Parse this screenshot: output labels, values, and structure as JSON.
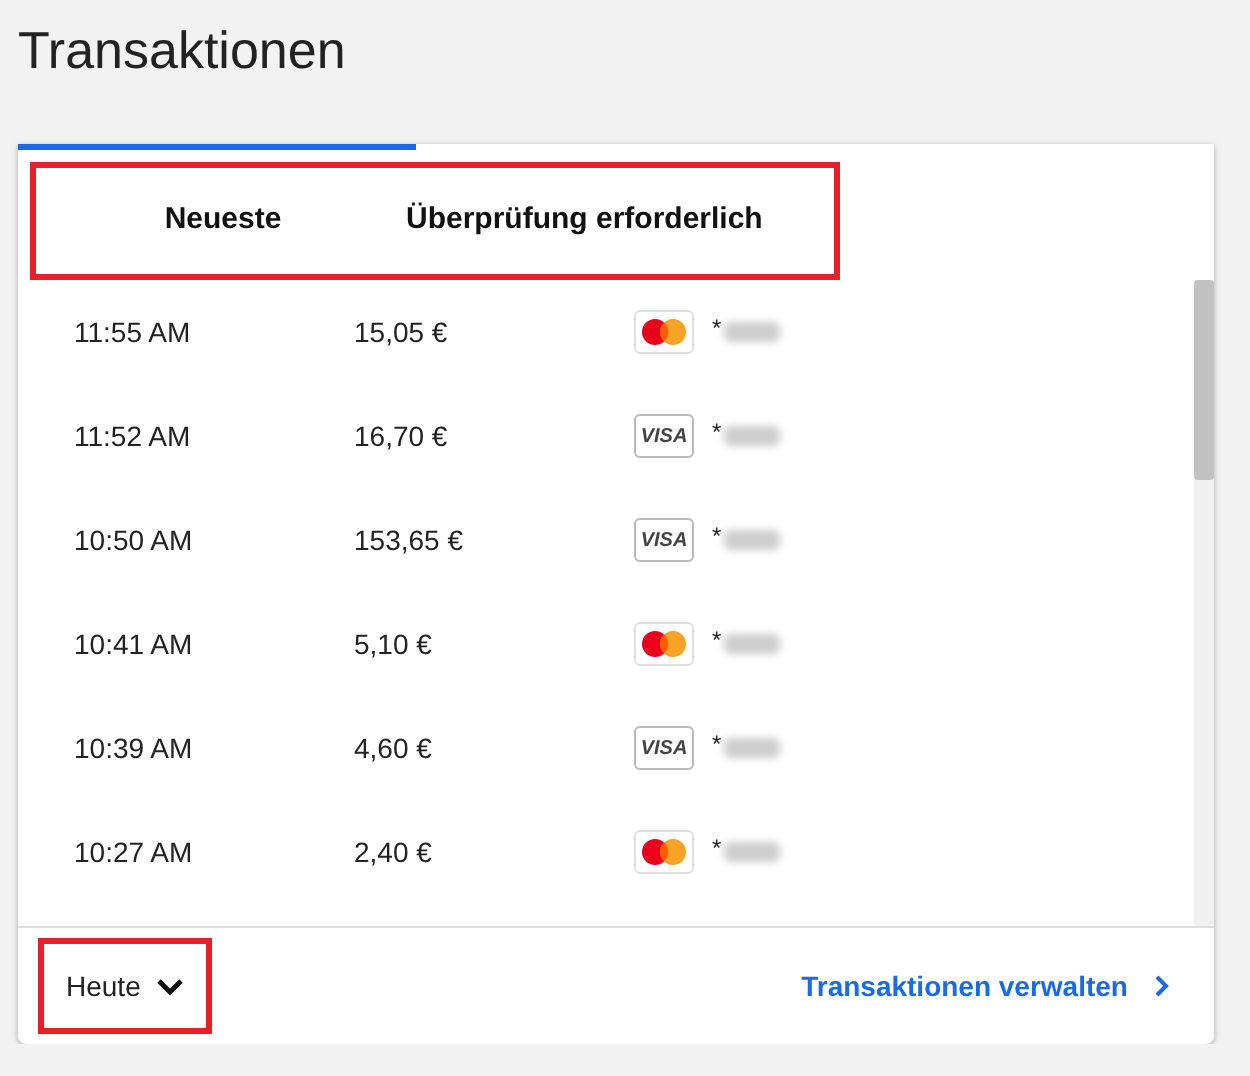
{
  "title": "Transaktionen",
  "tabs_highlighted": true,
  "tabs": [
    {
      "label": "Neueste",
      "selected": true
    },
    {
      "label": "Überprüfung erforderlich",
      "selected": false
    }
  ],
  "rows": [
    {
      "time": "11:55 AM",
      "amount": "15,05 €",
      "card": {
        "kind": "mastercard"
      },
      "masked": "*"
    },
    {
      "time": "11:52 AM",
      "amount": "16,70 €",
      "card": {
        "kind": "visa",
        "label": "VISA"
      },
      "masked": "*"
    },
    {
      "time": "10:50 AM",
      "amount": "153,65 €",
      "card": {
        "kind": "visa",
        "label": "VISA"
      },
      "masked": "*"
    },
    {
      "time": "10:41 AM",
      "amount": "5,10 €",
      "card": {
        "kind": "mastercard"
      },
      "masked": "*"
    },
    {
      "time": "10:39 AM",
      "amount": "4,60 €",
      "card": {
        "kind": "visa",
        "label": "VISA"
      },
      "masked": "*"
    },
    {
      "time": "10:27 AM",
      "amount": "2,40 €",
      "card": {
        "kind": "mastercard"
      },
      "masked": "*"
    }
  ],
  "period": {
    "value": "Heute",
    "highlighted": true
  },
  "manage_link": "Transaktionen verwalten"
}
